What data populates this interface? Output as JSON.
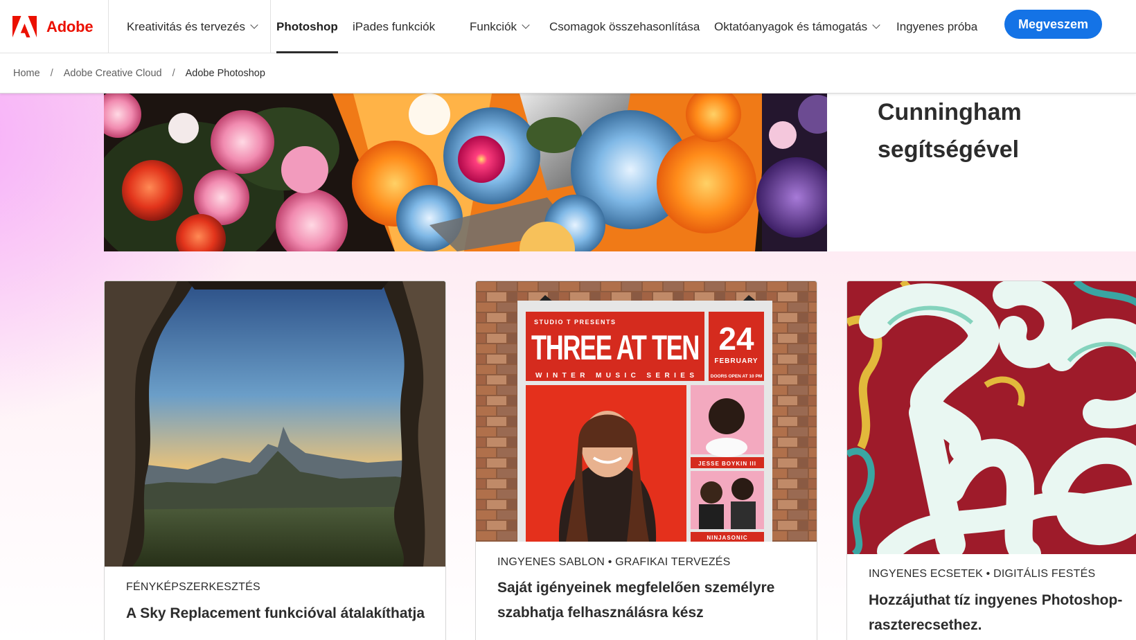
{
  "brand": {
    "name": "Adobe"
  },
  "nav": {
    "category": "Kreativitás és tervezés",
    "items": [
      {
        "label": "Photoshop",
        "active": true
      },
      {
        "label": "iPades funkciók"
      },
      {
        "label": "Funkciók",
        "dropdown": true
      },
      {
        "label": "Csomagok összehasonlítása"
      },
      {
        "label": "Oktatóanyagok és támogatás",
        "dropdown": true
      },
      {
        "label": "Ingyenes próba"
      }
    ],
    "buy_label": "Megveszem"
  },
  "breadcrumb": [
    "Home",
    "Adobe Creative Cloud",
    "Adobe Photoshop"
  ],
  "hero": {
    "title_lines": [
      "Cunningham",
      "segítségével"
    ]
  },
  "poster": {
    "presenter": "STUDIO T PRESENTS",
    "headline": "THREE AT TEN",
    "day": "24",
    "month": "FEBRUARY",
    "series": "WINTER MUSIC SERIES",
    "doors": "DOORS OPEN AT 10 PM",
    "artist_1": "JESSE BOYKIN III",
    "artist_2": "NINJASONIC"
  },
  "cards": [
    {
      "eyebrow": "FÉNYKÉPSZERKESZTÉS",
      "title": "A Sky Replacement funkcióval átalakíthatja"
    },
    {
      "eyebrow": "INGYENES SABLON • GRAFIKAI TERVEZÉS",
      "title": "Saját igényeinek megfelelően személyre szabhatja felhasználásra kész"
    },
    {
      "eyebrow": "INGYENES ECSETEK • DIGITÁLIS FESTÉS",
      "title": "Hozzájuthat tíz ingyenes Photoshop-raszterecsethez."
    }
  ],
  "colors": {
    "brand_red": "#eb1000",
    "cta_blue": "#1473e6",
    "text": "#2c2c2c"
  }
}
